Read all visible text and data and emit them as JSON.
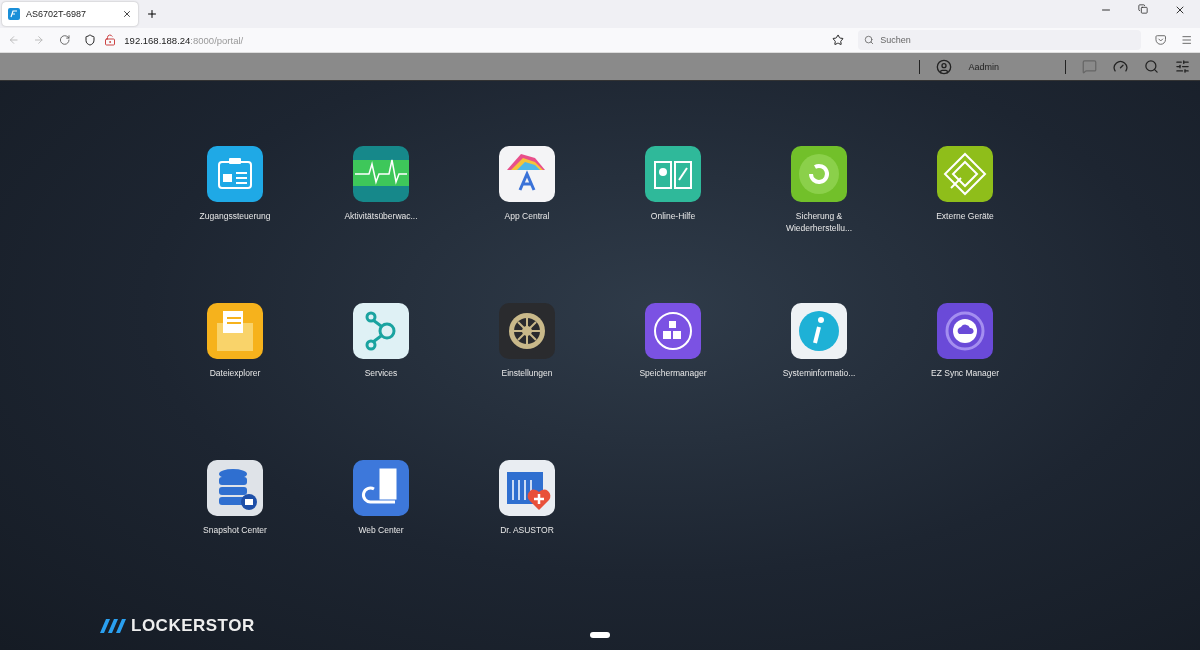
{
  "browser": {
    "tab": {
      "title": "AS6702T-6987",
      "selected": true
    },
    "url": {
      "host": "192.168.188.24",
      "path": ":8000/portal/"
    },
    "search": {
      "placeholder": "Suchen"
    }
  },
  "toolbar": {
    "user": "Aadmin"
  },
  "apps": [
    {
      "label": "Zugangssteuerung",
      "kind": "access"
    },
    {
      "label": "Aktivitätsüberwac...",
      "kind": "monitor"
    },
    {
      "label": "App Central",
      "kind": "appcentral"
    },
    {
      "label": "Online-Hilfe",
      "kind": "help"
    },
    {
      "label": "Sicherung & Wiederherstellu...",
      "kind": "backup"
    },
    {
      "label": "Externe Geräte",
      "kind": "external"
    },
    {
      "label": "Dateiexplorer",
      "kind": "files"
    },
    {
      "label": "Services",
      "kind": "services"
    },
    {
      "label": "Einstellungen",
      "kind": "settings"
    },
    {
      "label": "Speichermanager",
      "kind": "storage"
    },
    {
      "label": "Systeminformatio...",
      "kind": "info"
    },
    {
      "label": "EZ Sync Manager",
      "kind": "sync"
    },
    {
      "label": "Snapshot Center",
      "kind": "snapshot"
    },
    {
      "label": "Web Center",
      "kind": "web"
    },
    {
      "label": "Dr. ASUSTOR",
      "kind": "doctor"
    }
  ],
  "brand": {
    "name": "LOCKERSTOR"
  },
  "pages": [
    {
      "selected": true
    }
  ]
}
